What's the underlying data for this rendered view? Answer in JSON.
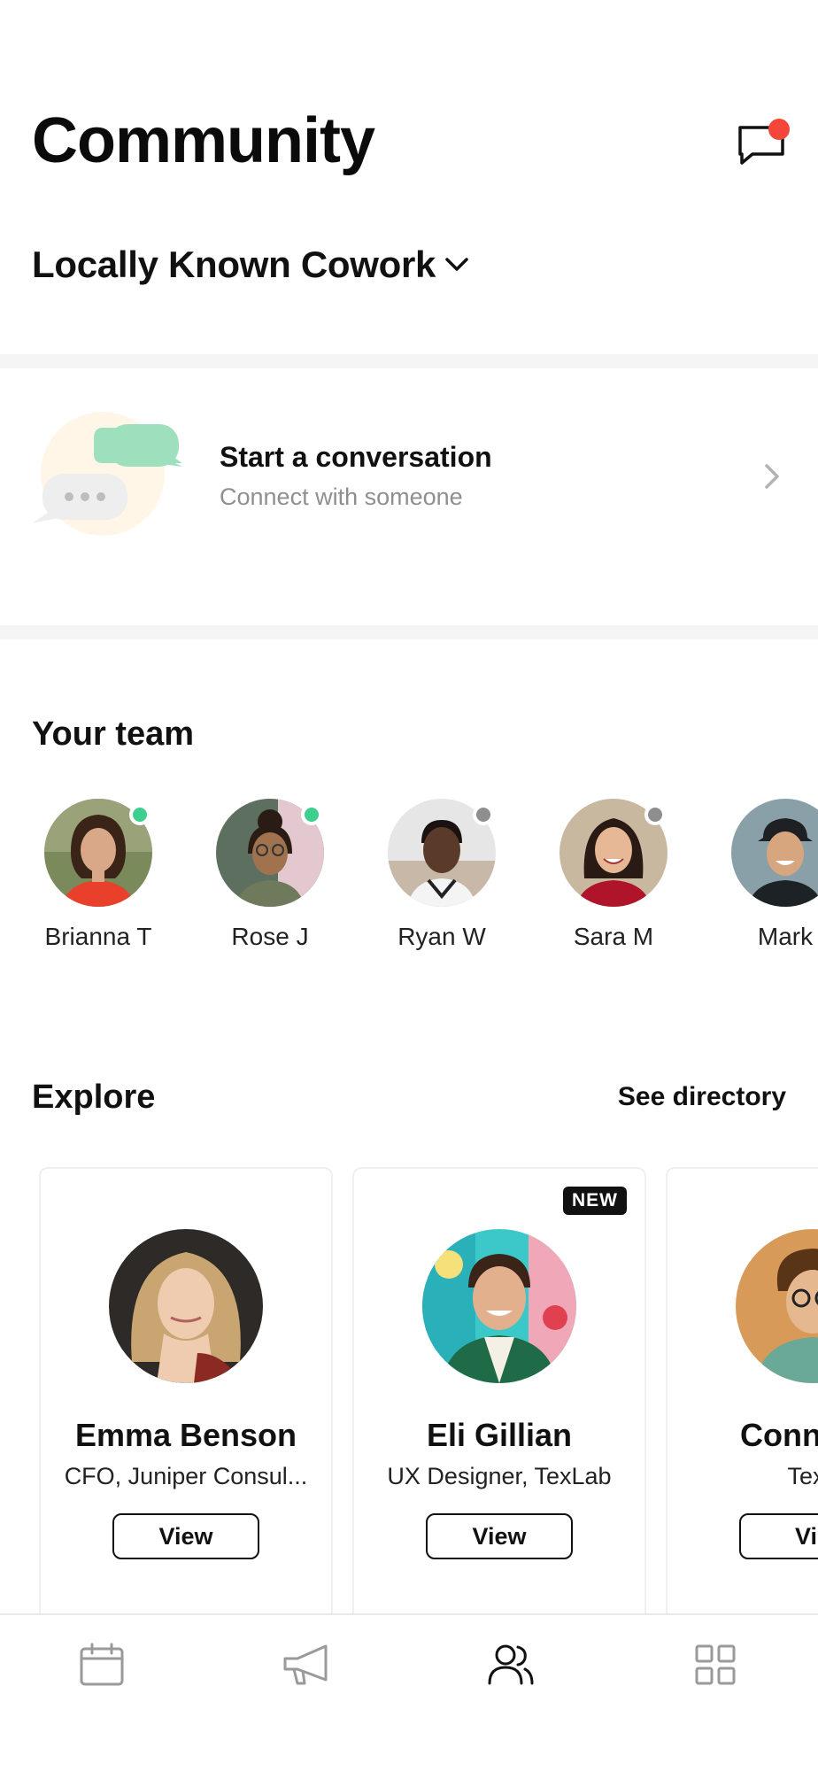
{
  "header": {
    "title": "Community",
    "messages_icon": "chat-bubble-icon",
    "has_unread": true
  },
  "location": {
    "name": "Locally Known Cowork",
    "icon": "chevron-down-icon"
  },
  "conversation": {
    "title": "Start a conversation",
    "subtitle": "Connect with someone",
    "icon": "chevron-right-icon"
  },
  "team": {
    "title": "Your team",
    "members": [
      {
        "name": "Brianna T",
        "status": "online"
      },
      {
        "name": "Rose J",
        "status": "online"
      },
      {
        "name": "Ryan W",
        "status": "offline"
      },
      {
        "name": "Sara M",
        "status": "offline"
      },
      {
        "name": "Mark",
        "status": "unknown"
      }
    ]
  },
  "explore": {
    "title": "Explore",
    "see_directory": "See directory",
    "cards": [
      {
        "name": "Emma Benson",
        "role": "CFO, Juniper Consul...",
        "button": "View",
        "badge": ""
      },
      {
        "name": "Eli Gillian",
        "role": "UX Designer, TexLab",
        "button": "View",
        "badge": "NEW"
      },
      {
        "name": "Connor D",
        "role": "TexL",
        "button": "Vie",
        "badge": ""
      }
    ]
  },
  "tabbar": {
    "tabs": [
      {
        "icon": "calendar-icon",
        "active": false
      },
      {
        "icon": "megaphone-icon",
        "active": false
      },
      {
        "icon": "people-icon",
        "active": true
      },
      {
        "icon": "grid-icon",
        "active": false
      }
    ]
  },
  "colors": {
    "online": "#3ecf8e",
    "offline": "#8e8e8e",
    "notification": "#f4473a",
    "bubble_green": "#9ee0bd"
  }
}
